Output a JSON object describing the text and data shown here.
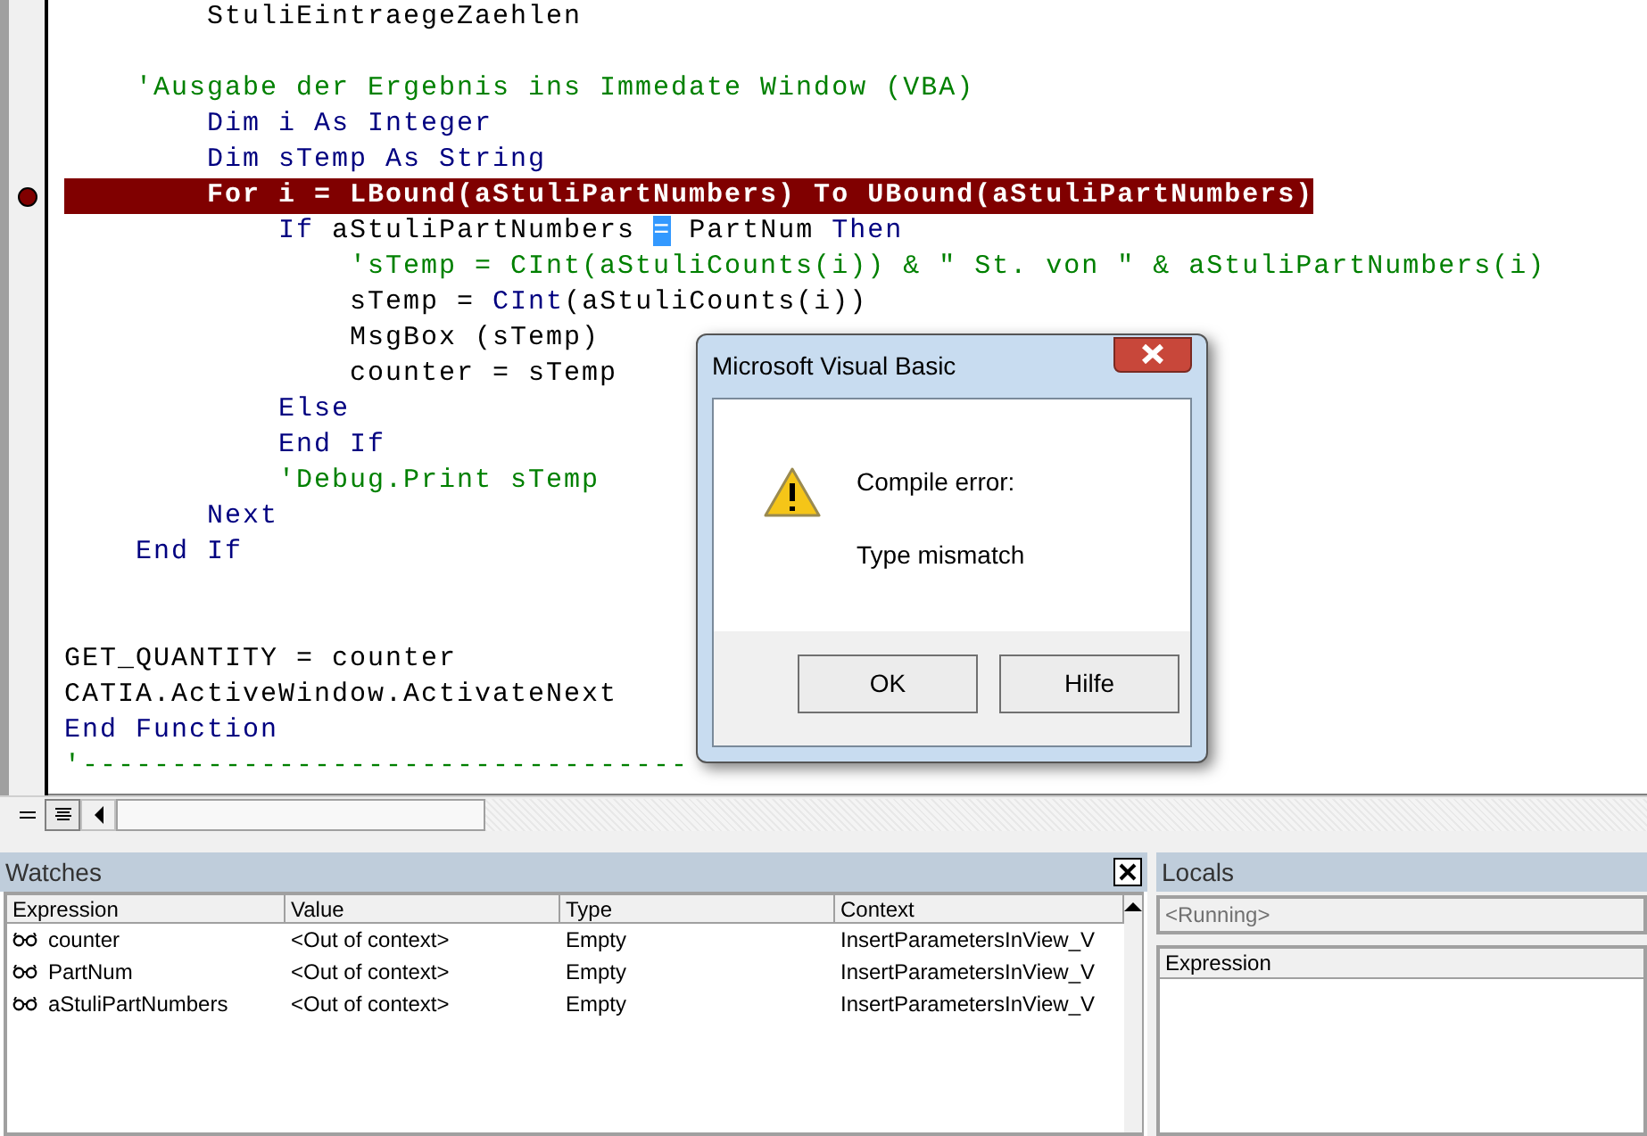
{
  "code_lines": [
    {
      "breakpoint": false,
      "current": false,
      "segments": [
        {
          "kind": "plain",
          "text": "        StuliEintraegeZaehlen"
        }
      ]
    },
    {
      "breakpoint": false,
      "current": false
    },
    {
      "breakpoint": false,
      "current": false,
      "segments": [
        {
          "kind": "comment",
          "text": "    'Ausgabe der Ergebnis ins Immedate Window (VBA)"
        }
      ]
    },
    {
      "breakpoint": false,
      "current": false,
      "segments": [
        {
          "kind": "keyword",
          "text": "        Dim i As Integer"
        }
      ]
    },
    {
      "breakpoint": false,
      "current": false,
      "segments": [
        {
          "kind": "keyword",
          "text": "        Dim sTemp As String"
        }
      ]
    },
    {
      "breakpoint": true,
      "current": true,
      "segments": [
        {
          "kind": "plain",
          "text": "        For i = LBound(aStuliPartNumbers) To UBound(aStuliPartNumbers)"
        }
      ]
    },
    {
      "breakpoint": false,
      "current": false,
      "segments": [
        {
          "kind": "keyword",
          "text": "            If "
        },
        {
          "kind": "plain",
          "text": "aStuliPartNumbers "
        },
        {
          "kind": "selection",
          "text": "="
        },
        {
          "kind": "plain",
          "text": " PartNum "
        },
        {
          "kind": "keyword",
          "text": "Then"
        }
      ]
    },
    {
      "breakpoint": false,
      "current": false,
      "segments": [
        {
          "kind": "comment",
          "text": "                'sTemp = CInt(aStuliCounts(i)) & \" St. von \" & aStuliPartNumbers(i)"
        }
      ]
    },
    {
      "breakpoint": false,
      "current": false,
      "segments": [
        {
          "kind": "plain",
          "text": "                sTemp = "
        },
        {
          "kind": "keyword",
          "text": "CInt"
        },
        {
          "kind": "plain",
          "text": "(aStuliCounts(i))"
        }
      ]
    },
    {
      "breakpoint": false,
      "current": false,
      "segments": [
        {
          "kind": "plain",
          "text": "                MsgBox (sTemp)"
        }
      ]
    },
    {
      "breakpoint": false,
      "current": false,
      "segments": [
        {
          "kind": "plain",
          "text": "                counter = sTemp"
        }
      ]
    },
    {
      "breakpoint": false,
      "current": false,
      "segments": [
        {
          "kind": "keyword",
          "text": "            Else"
        }
      ]
    },
    {
      "breakpoint": false,
      "current": false,
      "segments": [
        {
          "kind": "keyword",
          "text": "            End If"
        }
      ]
    },
    {
      "breakpoint": false,
      "current": false,
      "segments": [
        {
          "kind": "comment",
          "text": "            'Debug.Print sTemp"
        }
      ]
    },
    {
      "breakpoint": false,
      "current": false,
      "segments": [
        {
          "kind": "keyword",
          "text": "        Next"
        }
      ]
    },
    {
      "breakpoint": false,
      "current": false,
      "segments": [
        {
          "kind": "keyword",
          "text": "    End If"
        }
      ]
    },
    {
      "breakpoint": false,
      "current": false
    },
    {
      "breakpoint": false,
      "current": false
    },
    {
      "breakpoint": false,
      "current": false,
      "segments": [
        {
          "kind": "plain",
          "text": "GET_QUANTITY = counter"
        }
      ]
    },
    {
      "breakpoint": false,
      "current": false,
      "segments": [
        {
          "kind": "plain",
          "text": "CATIA.ActiveWindow.ActivateNext"
        }
      ]
    },
    {
      "breakpoint": false,
      "current": false,
      "segments": [
        {
          "kind": "keyword",
          "text": "End Function"
        }
      ]
    },
    {
      "breakpoint": false,
      "current": false,
      "segments": [
        {
          "kind": "comment",
          "text": "'----------------------------------"
        }
      ]
    }
  ],
  "dialog": {
    "title": "Microsoft Visual Basic",
    "heading": "Compile error:",
    "message": "Type mismatch",
    "buttons": [
      "OK",
      "Hilfe"
    ]
  },
  "watches": {
    "title": "Watches",
    "columns": [
      "Expression",
      "Value",
      "Type",
      "Context"
    ],
    "rows": [
      {
        "cells": [
          "counter",
          "<Out of context>",
          "Empty",
          "InsertParametersInView_V"
        ]
      },
      {
        "cells": [
          "PartNum",
          "<Out of context>",
          "Empty",
          "InsertParametersInView_V"
        ]
      },
      {
        "cells": [
          "aStuliPartNumbers",
          "<Out of context>",
          "Empty",
          "InsertParametersInView_V"
        ]
      }
    ]
  },
  "locals": {
    "title": "Locals",
    "status": "<Running>",
    "columns": [
      "Expression"
    ]
  }
}
